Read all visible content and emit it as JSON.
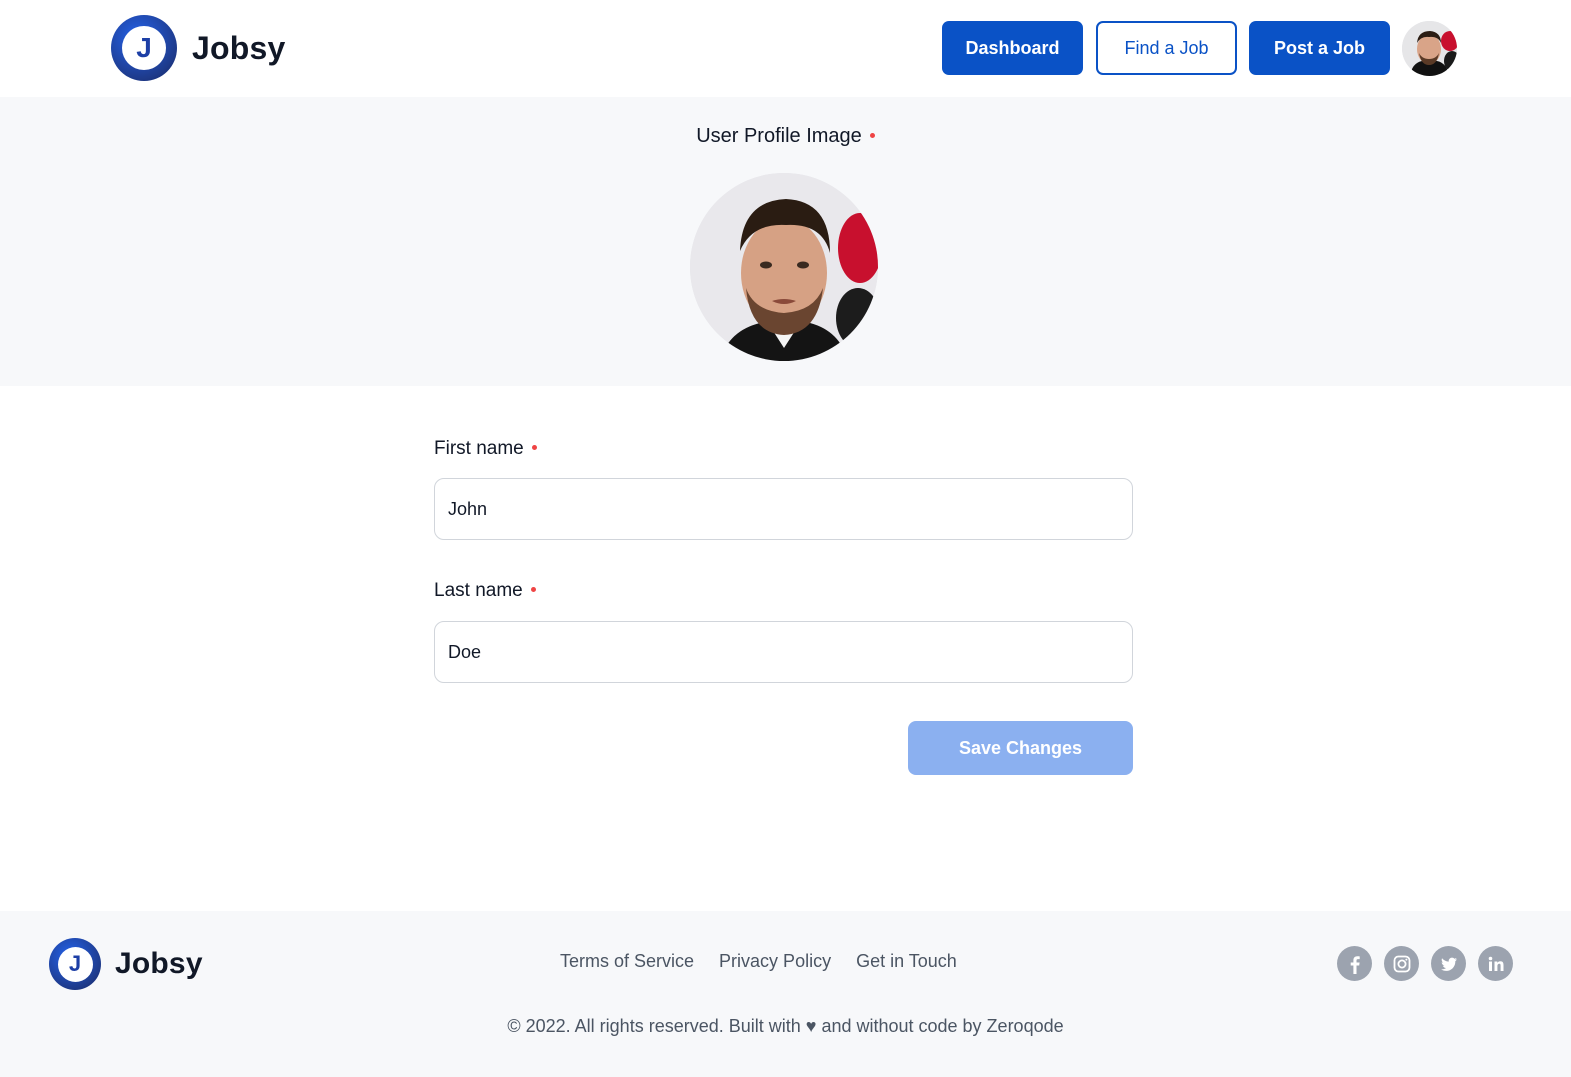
{
  "brand": {
    "name": "Jobsy",
    "logo_letter": "J"
  },
  "nav": {
    "dashboard": "Dashboard",
    "find_job": "Find a Job",
    "post_job": "Post a Job"
  },
  "profile": {
    "image_label": "User Profile Image"
  },
  "form": {
    "first_name_label": "First name",
    "first_name_value": "John",
    "last_name_label": "Last name",
    "last_name_value": "Doe",
    "save_label": "Save Changes"
  },
  "footer": {
    "links": [
      "Terms of Service",
      "Privacy Policy",
      "Get in Touch"
    ],
    "copyright": "© 2022. All rights reserved. Built with ♥ and without code by Zeroqode",
    "socials": [
      "facebook-icon",
      "instagram-icon",
      "twitter-icon",
      "linkedin-icon"
    ]
  },
  "colors": {
    "primary": "#0a52c6",
    "save_disabled": "#8bb0f0",
    "required_dot": "#ef4444",
    "band_bg": "#f7f8fa",
    "social_gray": "#9ca3af"
  }
}
